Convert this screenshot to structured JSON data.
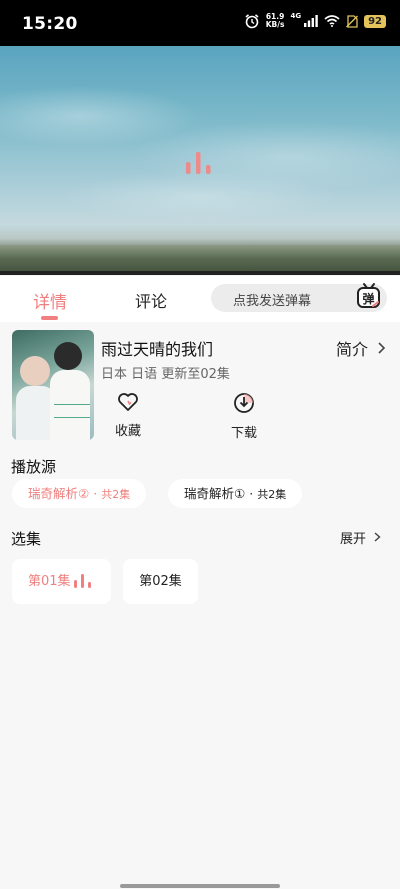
{
  "status_bar": {
    "time": "15:20",
    "net_speed_value": "61.9",
    "net_speed_unit": "KB/s",
    "network_type": "4G",
    "battery": "92"
  },
  "video": {
    "state_icon": "loading-bars-icon"
  },
  "tabs": [
    {
      "label": "详情",
      "active": true
    },
    {
      "label": "评论",
      "active": false
    }
  ],
  "danmaku": {
    "placeholder": "点我发送弹幕",
    "icon_glyph": "弹"
  },
  "show": {
    "title": "雨过天晴的我们",
    "intro_label": "简介",
    "region": "日本",
    "language": "日语",
    "update_status": "更新至02集"
  },
  "actions": {
    "favorite_label": "收藏",
    "download_label": "下载"
  },
  "sources": {
    "heading": "播放源",
    "items": [
      {
        "name": "瑞奇解析②",
        "count": "共2集",
        "selected": true
      },
      {
        "name": "瑞奇解析①",
        "count": "共2集",
        "selected": false
      }
    ]
  },
  "episodes": {
    "heading": "选集",
    "expand_label": "展开",
    "items": [
      {
        "label": "第01集",
        "playing": true
      },
      {
        "label": "第02集",
        "playing": false
      }
    ]
  },
  "colors": {
    "accent": "#f07f7f"
  }
}
